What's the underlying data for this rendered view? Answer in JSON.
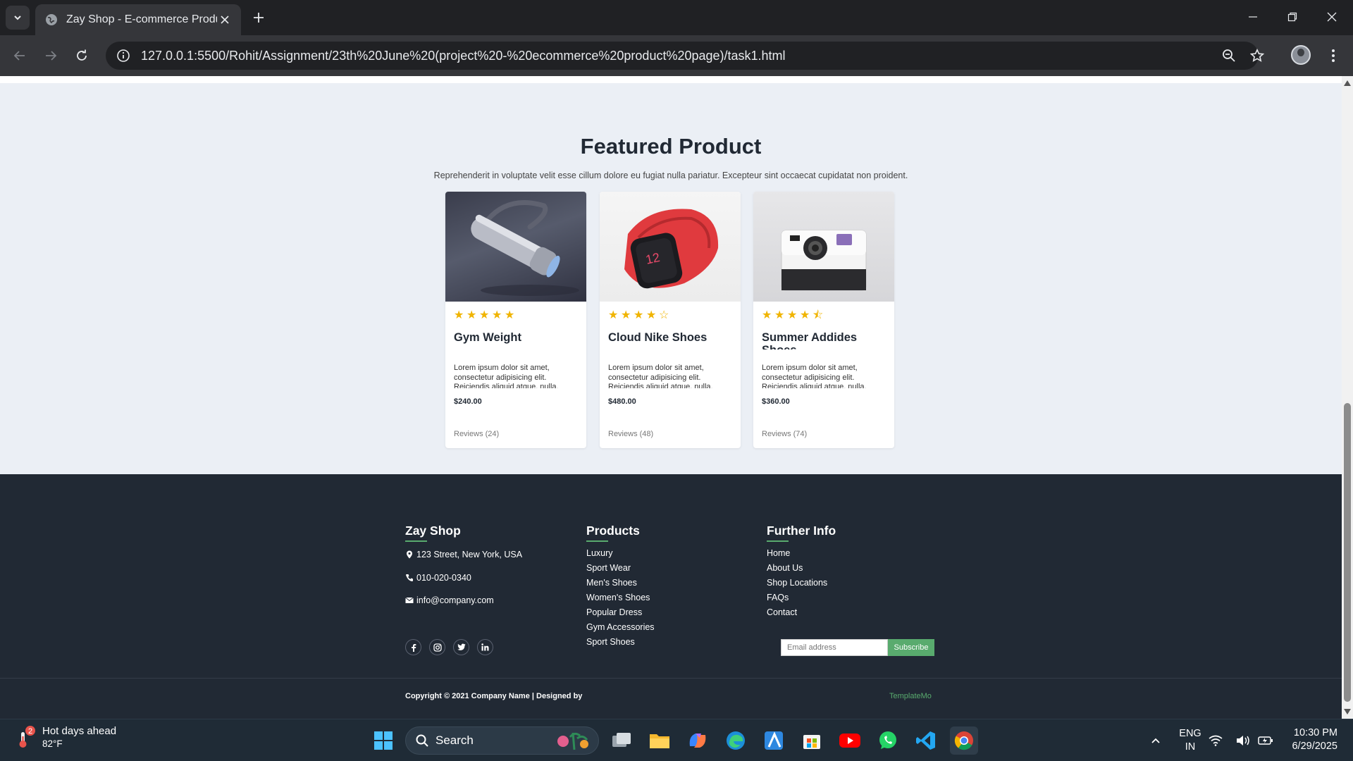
{
  "browser": {
    "tab_title": "Zay Shop - E-commerce Product Page",
    "url": "127.0.0.1:5500/Rohit/Assignment/23th%20June%20(project%20-%20ecommerce%20product%20page)/task1.html"
  },
  "featured": {
    "title": "Featured Product",
    "subtitle": "Reprehenderit in voluptate velit esse cillum dolore eu fugiat nulla pariatur. Excepteur sint occaecat cupidatat non proident.",
    "products": [
      {
        "name": "Gym Weight",
        "rating": 5,
        "description": "Lorem ipsum dolor sit amet, consectetur adipisicing elit. Reiciendis aliquid atque, nulla.",
        "price": "$240.00",
        "reviews": "Reviews (24)",
        "image": "flashlight"
      },
      {
        "name": "Cloud Nike Shoes",
        "rating": 4,
        "description": "Lorem ipsum dolor sit amet, consectetur adipisicing elit. Reiciendis aliquid atque, nulla.",
        "price": "$480.00",
        "reviews": "Reviews (48)",
        "image": "smartwatch"
      },
      {
        "name": "Summer Addides Shoes",
        "rating": 4.5,
        "description": "Lorem ipsum dolor sit amet, consectetur adipisicing elit. Reiciendis aliquid atque, nulla.",
        "price": "$360.00",
        "reviews": "Reviews (74)",
        "image": "instant-camera"
      }
    ]
  },
  "footer": {
    "brand": {
      "title": "Zay Shop",
      "address": "123 Street, New York, USA",
      "phone": "010-020-0340",
      "email": "info@company.com"
    },
    "products": {
      "title": "Products",
      "links": [
        "Luxury",
        "Sport Wear",
        "Men's Shoes",
        "Women's Shoes",
        "Popular Dress",
        "Gym Accessories",
        "Sport Shoes"
      ]
    },
    "further": {
      "title": "Further Info",
      "links": [
        "Home",
        "About Us",
        "Shop Locations",
        "FAQs",
        "Contact"
      ]
    },
    "socials": [
      "facebook-icon",
      "instagram-icon",
      "twitter-icon",
      "linkedin-icon"
    ],
    "subscribe": {
      "placeholder": "Email address",
      "button": "Subscribe"
    },
    "copyright": "Copyright © 2021 Company Name | Designed by",
    "designer": "TemplateMo"
  },
  "colors": {
    "accent": "#59ab6e",
    "star": "#f0b400",
    "footer_bg": "#212934",
    "page_bg": "#ebeff5"
  },
  "taskbar": {
    "weather_title": "Hot days ahead",
    "weather_temp": "82°F",
    "weather_badge": "2",
    "search_label": "Search",
    "lang_top": "ENG",
    "lang_bottom": "IN",
    "time": "10:30 PM",
    "date": "6/29/2025"
  }
}
